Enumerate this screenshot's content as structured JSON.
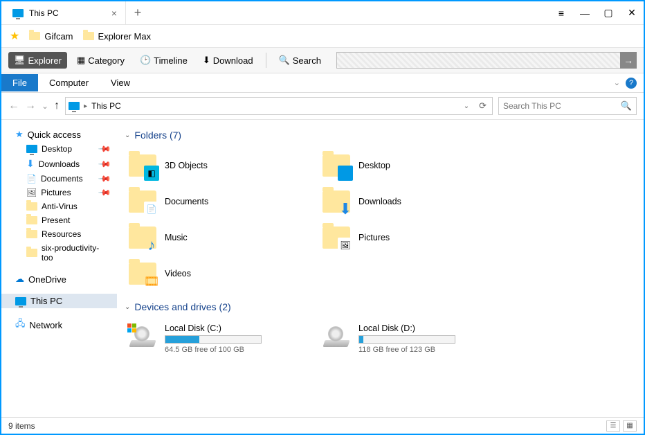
{
  "titlebar": {
    "tab_title": "This PC"
  },
  "bookmarks": {
    "items": [
      "Gifcam",
      "Explorer Max"
    ]
  },
  "toolbar": {
    "explorer": "Explorer",
    "category": "Category",
    "timeline": "Timeline",
    "download": "Download",
    "search": "Search"
  },
  "ribbon": {
    "file": "File",
    "computer": "Computer",
    "view": "View"
  },
  "nav": {
    "crumb": "This PC",
    "search_placeholder": "Search This PC"
  },
  "sidebar": {
    "quick_access": "Quick access",
    "qa_items": [
      {
        "label": "Desktop",
        "pinned": true
      },
      {
        "label": "Downloads",
        "pinned": true
      },
      {
        "label": "Documents",
        "pinned": true
      },
      {
        "label": "Pictures",
        "pinned": true
      },
      {
        "label": "Anti-Virus",
        "pinned": false
      },
      {
        "label": "Present",
        "pinned": false
      },
      {
        "label": "Resources",
        "pinned": false
      },
      {
        "label": "six-productivity-too",
        "pinned": false
      }
    ],
    "onedrive": "OneDrive",
    "this_pc": "This PC",
    "network": "Network"
  },
  "content": {
    "folders_header": "Folders (7)",
    "folders": [
      {
        "label": "3D Objects"
      },
      {
        "label": "Desktop"
      },
      {
        "label": "Documents"
      },
      {
        "label": "Downloads"
      },
      {
        "label": "Music"
      },
      {
        "label": "Pictures"
      },
      {
        "label": "Videos"
      }
    ],
    "drives_header": "Devices and drives (2)",
    "drives": [
      {
        "name": "Local Disk (C:)",
        "free_text": "64.5 GB free of 100 GB",
        "used_pct": 35.5,
        "is_system": true
      },
      {
        "name": "Local Disk (D:)",
        "free_text": "118 GB free of 123 GB",
        "used_pct": 4.1,
        "is_system": false
      }
    ]
  },
  "status": {
    "count_text": "9 items"
  }
}
